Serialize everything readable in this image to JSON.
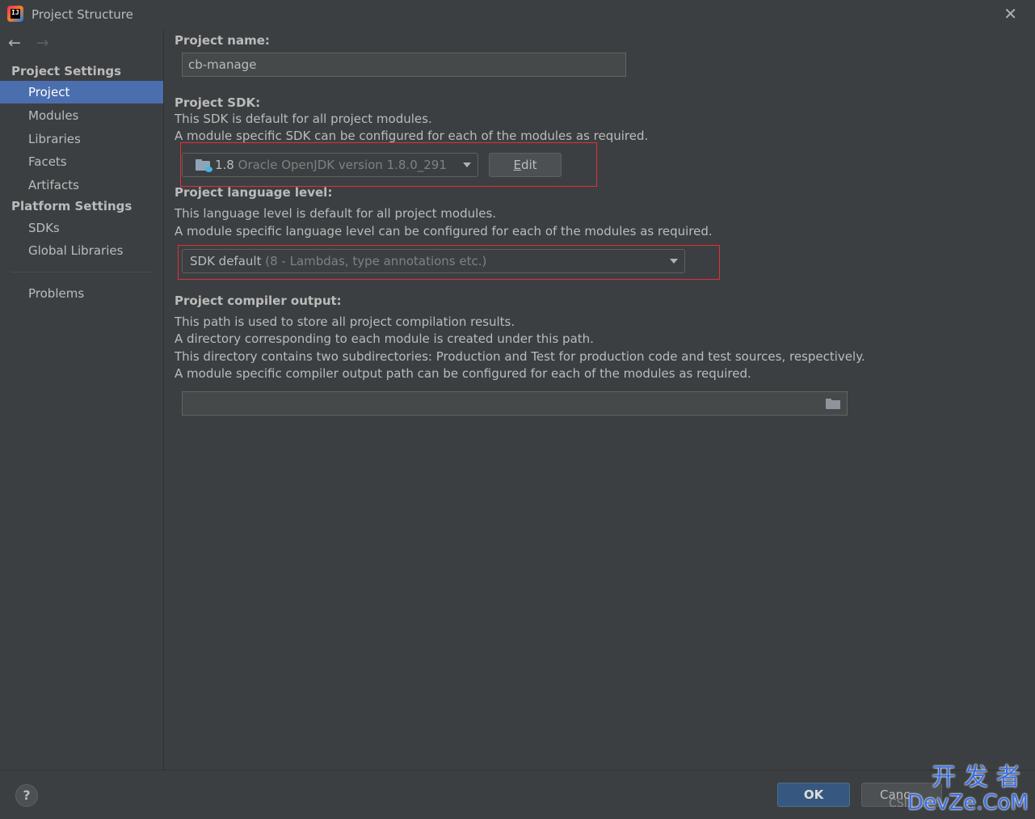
{
  "window": {
    "title": "Project Structure",
    "close_icon": "close-icon",
    "app_icon_letters": "IJ"
  },
  "sidebar": {
    "back_icon": "←",
    "forward_icon": "→",
    "project_settings_header": "Project Settings",
    "project_settings_items": [
      {
        "label": "Project",
        "selected": true
      },
      {
        "label": "Modules"
      },
      {
        "label": "Libraries"
      },
      {
        "label": "Facets"
      },
      {
        "label": "Artifacts"
      }
    ],
    "platform_settings_header": "Platform Settings",
    "platform_settings_items": [
      {
        "label": "SDKs"
      },
      {
        "label": "Global Libraries"
      }
    ],
    "problems_label": "Problems"
  },
  "main": {
    "project_name_label": "Project name:",
    "project_name_value": "cb-manage",
    "sdk_label": "Project SDK:",
    "sdk_desc_1": "This SDK is default for all project modules.",
    "sdk_desc_2": "A module specific SDK can be configured for each of the modules as required.",
    "sdk_version": "1.8",
    "sdk_name": "Oracle OpenJDK version 1.8.0_291",
    "sdk_edit_prefix": "",
    "sdk_edit_mnemonic": "E",
    "sdk_edit_rest": "dit",
    "lang_label": "Project language level:",
    "lang_desc_1": "This language level is default for all project modules.",
    "lang_desc_2": "A module specific language level can be configured for each of the modules as required.",
    "lang_value": "SDK default",
    "lang_hint": "(8 - Lambdas, type annotations etc.)",
    "output_label": "Project compiler output:",
    "output_desc_1": "This path is used to store all project compilation results.",
    "output_desc_2": "A directory corresponding to each module is created under this path.",
    "output_desc_3": "This directory contains two subdirectories: Production and Test for production code and test sources, respectively.",
    "output_desc_4": "A module specific compiler output path can be configured for each of the modules as required.",
    "output_value": ""
  },
  "footer": {
    "help_label": "?",
    "ok_label": "OK",
    "cancel_label": "Canc",
    "watermark_line1": "开发者",
    "watermark_line2": "DevZe.CoM",
    "watermark_csdn": "CSI"
  },
  "colors": {
    "background": "#3c3f41",
    "selection": "#4b6eaf",
    "ok_button": "#365880",
    "highlight_box": "#e0303a"
  }
}
